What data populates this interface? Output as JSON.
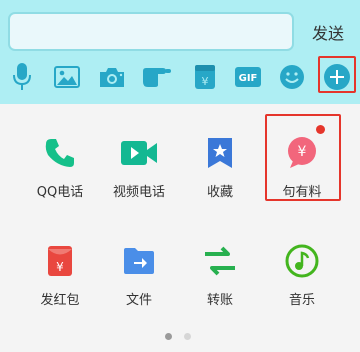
{
  "input": {
    "value": "",
    "send_label": "发送"
  },
  "toolbar": {
    "tools": [
      {
        "name": "microphone-icon"
      },
      {
        "name": "image-icon"
      },
      {
        "name": "camera-icon"
      },
      {
        "name": "hand-poke-icon"
      },
      {
        "name": "red-packet-icon"
      },
      {
        "name": "gif-icon",
        "label": "GIF"
      },
      {
        "name": "emoji-icon"
      },
      {
        "name": "plus-icon"
      }
    ]
  },
  "panel": {
    "items": [
      {
        "label": "QQ电话",
        "icon": "phone-icon"
      },
      {
        "label": "视频电话",
        "icon": "video-call-icon"
      },
      {
        "label": "收藏",
        "icon": "favorites-icon"
      },
      {
        "label": "句有料",
        "icon": "yen-bubble-icon",
        "badge": true
      },
      {
        "label": "发红包",
        "icon": "red-envelope-icon"
      },
      {
        "label": "文件",
        "icon": "file-folder-icon"
      },
      {
        "label": "转账",
        "icon": "transfer-icon"
      },
      {
        "label": "音乐",
        "icon": "music-icon"
      }
    ]
  },
  "pagination": {
    "pages": 2,
    "current": 1
  },
  "colors": {
    "input_area_bg": "#aeeef3",
    "toolbar_icon": "#27a7c7",
    "highlight": "#e5352b",
    "phone": "#16c08a",
    "video": "#13b892",
    "favorites": "#3b78d8",
    "yen_bubble": "#f2667c",
    "red_envelope": "#e9473f",
    "file": "#4a8ee8",
    "transfer": "#27b04f",
    "music": "#43b51e"
  }
}
